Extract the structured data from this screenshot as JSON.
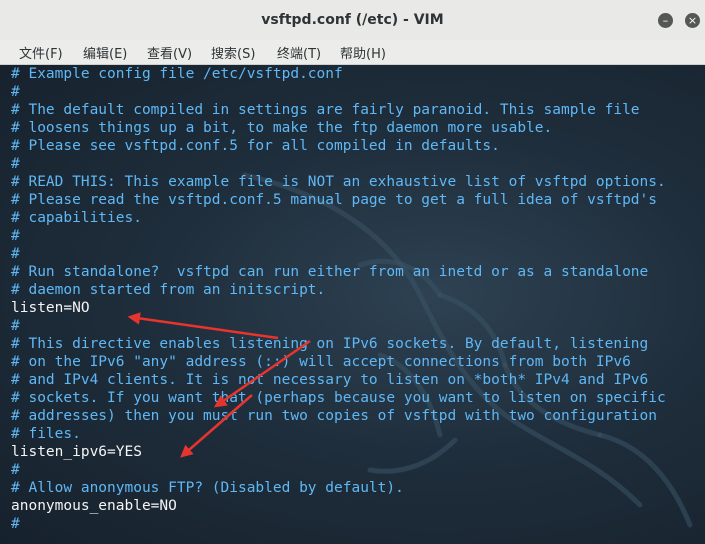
{
  "window": {
    "title": "vsftpd.conf (/etc) - VIM",
    "minimize_glyph": "–",
    "close_glyph": "×"
  },
  "menu": [
    {
      "label": "文件(F)"
    },
    {
      "label": "编辑(E)"
    },
    {
      "label": "查看(V)"
    },
    {
      "label": "搜索(S)"
    },
    {
      "label": "终端(T)"
    },
    {
      "label": "帮助(H)"
    }
  ],
  "editor": {
    "lines": [
      {
        "text": "# Example config file /etc/vsftpd.conf",
        "kind": "comment"
      },
      {
        "text": "#",
        "kind": "comment"
      },
      {
        "text": "# The default compiled in settings are fairly paranoid. This sample file",
        "kind": "comment"
      },
      {
        "text": "# loosens things up a bit, to make the ftp daemon more usable.",
        "kind": "comment"
      },
      {
        "text": "# Please see vsftpd.conf.5 for all compiled in defaults.",
        "kind": "comment"
      },
      {
        "text": "#",
        "kind": "comment"
      },
      {
        "text": "# READ THIS: This example file is NOT an exhaustive list of vsftpd options.",
        "kind": "comment"
      },
      {
        "text": "# Please read the vsftpd.conf.5 manual page to get a full idea of vsftpd's",
        "kind": "comment"
      },
      {
        "text": "# capabilities.",
        "kind": "comment"
      },
      {
        "text": "#",
        "kind": "comment"
      },
      {
        "text": "#",
        "kind": "comment"
      },
      {
        "text": "# Run standalone?  vsftpd can run either from an inetd or as a standalone",
        "kind": "comment"
      },
      {
        "text": "# daemon started from an initscript.",
        "kind": "comment"
      },
      {
        "text": "listen=NO",
        "kind": "code"
      },
      {
        "text": "#",
        "kind": "comment"
      },
      {
        "text": "# This directive enables listening on IPv6 sockets. By default, listening",
        "kind": "comment"
      },
      {
        "text": "# on the IPv6 \"any\" address (::) will accept connections from both IPv6",
        "kind": "comment"
      },
      {
        "text": "# and IPv4 clients. It is not necessary to listen on *both* IPv4 and IPv6",
        "kind": "comment"
      },
      {
        "text": "# sockets. If you want that (perhaps because you want to listen on specific",
        "kind": "comment"
      },
      {
        "text": "# addresses) then you must run two copies of vsftpd with two configuration",
        "kind": "comment"
      },
      {
        "text": "# files.",
        "kind": "comment"
      },
      {
        "text": "listen_ipv6=YES",
        "kind": "code"
      },
      {
        "text": "#",
        "kind": "comment"
      },
      {
        "text": "# Allow anonymous FTP? (Disabled by default).",
        "kind": "comment"
      },
      {
        "text": "anonymous_enable=NO",
        "kind": "code"
      },
      {
        "text": "#",
        "kind": "comment"
      }
    ]
  },
  "colors": {
    "comment": "#5fb8f5",
    "code": "#f4f4f4",
    "annotation_arrow": "#e8342e",
    "background": "#1f2e3c"
  },
  "annotations": {
    "arrow_count": 3,
    "targets": [
      "listen=NO",
      "listen_ipv6=YES"
    ]
  }
}
